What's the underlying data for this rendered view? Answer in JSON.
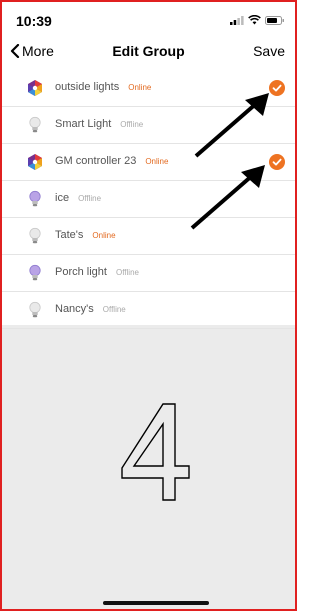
{
  "status_bar": {
    "time": "10:39"
  },
  "nav": {
    "back_label": "More",
    "title": "Edit Group",
    "save_label": "Save"
  },
  "colors": {
    "online": "#e36a20",
    "offline": "#aaaaaa",
    "check": "#ee7322",
    "border": "#e02020"
  },
  "devices": [
    {
      "name": "outside lights",
      "status": "Online",
      "icon": "rgb-controller-icon",
      "selected": true
    },
    {
      "name": "Smart Light",
      "status": "Offline",
      "icon": "white-bulb-icon",
      "selected": false
    },
    {
      "name": "GM controller 23",
      "status": "Online",
      "icon": "rgb-controller-icon",
      "selected": true
    },
    {
      "name": "ice",
      "status": "Offline",
      "icon": "color-bulb-icon",
      "selected": false
    },
    {
      "name": "Tate's",
      "status": "Online",
      "icon": "white-bulb-icon",
      "selected": false
    },
    {
      "name": "Porch light",
      "status": "Offline",
      "icon": "color-bulb-icon",
      "selected": false
    },
    {
      "name": "Nancy's",
      "status": "Offline",
      "icon": "white-bulb-icon",
      "selected": false
    }
  ],
  "annotation": {
    "number": "4"
  }
}
